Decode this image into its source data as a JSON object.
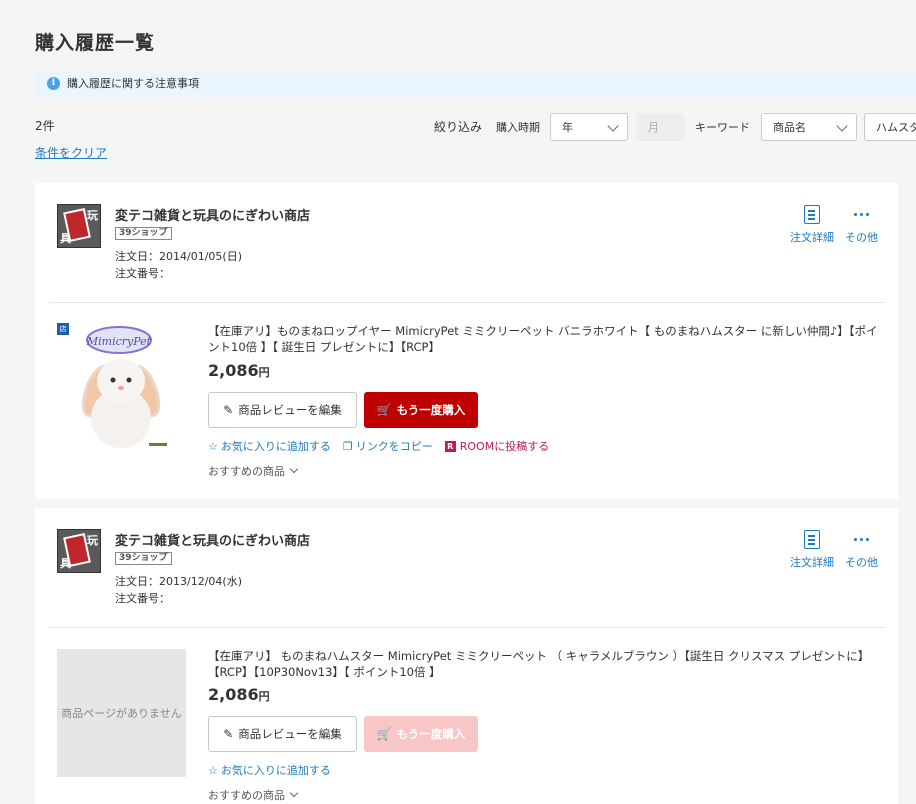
{
  "page": {
    "title": "購入履歴一覧"
  },
  "notice": {
    "text": "購入履歴に関する注意事項"
  },
  "results": {
    "count": "2件",
    "clear_link": "条件をクリア"
  },
  "filters": {
    "label": "絞り込み",
    "period_label": "購入時期",
    "year_value": "年",
    "month_value": "月",
    "keyword_label": "キーワード",
    "keyword_type_value": "商品名",
    "keyword_value": "ハムスタ"
  },
  "orders": [
    {
      "shop_name": "変テコ雑貨と玩具のにぎわい商店",
      "shop_badge": "39ショップ",
      "order_date": "注文日：2014/01/05(日)",
      "order_number": "注文番号：",
      "detail_label": "注文詳細",
      "more_label": "その他",
      "product_title": "【在庫アリ】ものまねロップイヤー MimicryPet ミミクリーペット バニラホワイト【 ものまねハムスター に新しい仲間♪】【ポイント10倍 】【 誕生日 プレゼントに】【RCP】",
      "price": "2,086",
      "price_unit": "円",
      "review_button": "商品レビューを編集",
      "rebuy_button": "もう一度購入",
      "favorite_link": "お気に入りに追加する",
      "copy_link": "リンクをコピー",
      "room_link": "ROOMに投稿する",
      "recommend": "おすすめの商品",
      "image_text": "MimicryPet"
    },
    {
      "shop_name": "変テコ雑貨と玩具のにぎわい商店",
      "shop_badge": "39ショップ",
      "order_date": "注文日：2013/12/04(水)",
      "order_number": "注文番号：",
      "detail_label": "注文詳細",
      "more_label": "その他",
      "product_title": "【在庫アリ】 ものまねハムスター MimicryPet ミミクリーペット （ キャラメルブラウン ）【誕生日 クリスマス プレゼントに】【RCP】【10P30Nov13】【 ポイント10倍 】",
      "price": "2,086",
      "price_unit": "円",
      "review_button": "商品レビューを編集",
      "rebuy_button": "もう一度購入",
      "favorite_link": "お気に入りに追加する",
      "no_image_text": "商品ページがありません",
      "recommend": "おすすめの商品"
    }
  ],
  "shop_logo_text": {
    "k1": "玩",
    "k2": "具"
  },
  "colors": {
    "accent": "#1d7bbf",
    "rebuy": "#bf0000",
    "rebuy_disabled": "#f8c6c6",
    "room": "#c2185b",
    "notice_bg": "#ebf5fd"
  }
}
